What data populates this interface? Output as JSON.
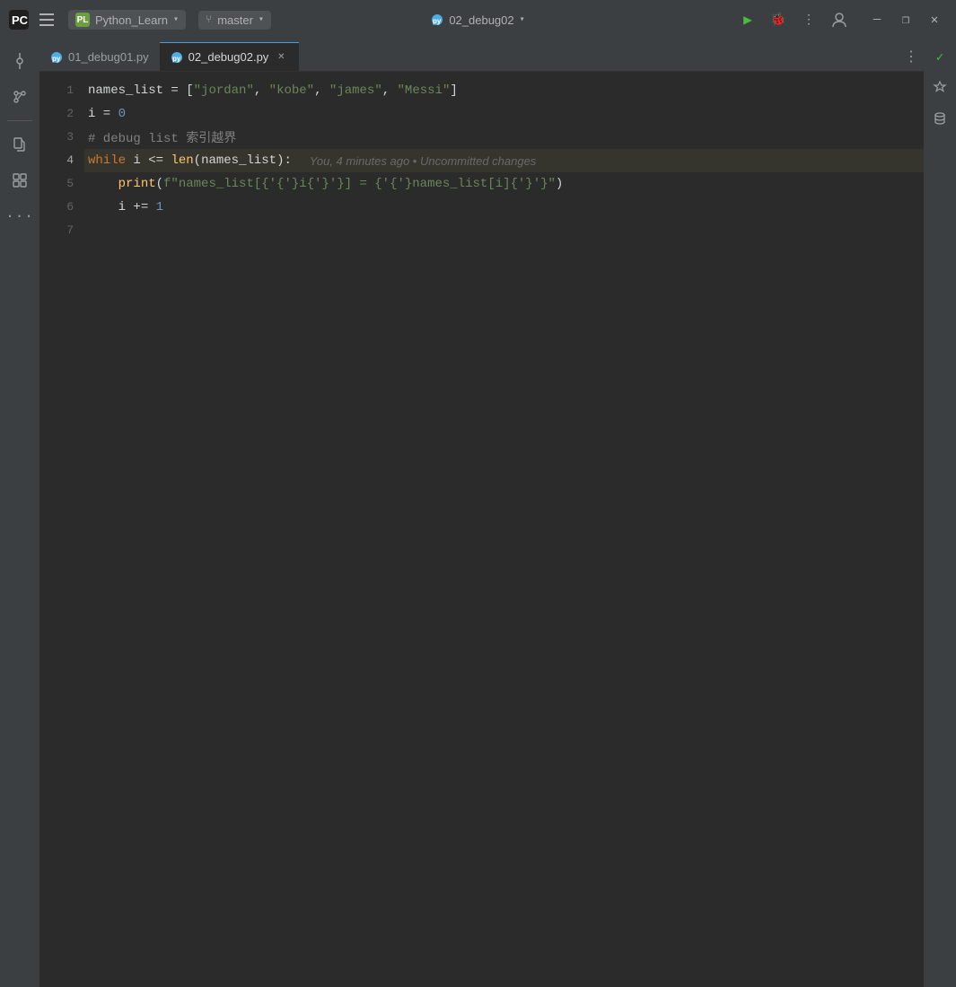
{
  "titleBar": {
    "appName": "PyCharm",
    "projectBadge": {
      "initials": "PL",
      "name": "Python_Learn",
      "chevron": "▾"
    },
    "branchBadge": {
      "name": "master",
      "chevron": "▾"
    },
    "fileTitle": {
      "name": "02_debug02",
      "chevron": "▾"
    },
    "runBtn": "▶",
    "debugBtn": "🐛",
    "moreBtn": "⋮",
    "userBtn": "👤",
    "minimizeBtn": "—",
    "maximizeBtn": "❐",
    "closeBtn": "✕"
  },
  "sidebar": {
    "icons": [
      {
        "id": "commit",
        "symbol": "⊙",
        "active": true
      },
      {
        "id": "branch",
        "symbol": "⑂",
        "active": false
      },
      {
        "id": "folder",
        "symbol": "📁",
        "active": false
      },
      {
        "id": "plugins",
        "symbol": "⊞",
        "active": false
      },
      {
        "id": "more",
        "symbol": "···",
        "active": false
      }
    ]
  },
  "tabs": [
    {
      "id": "tab1",
      "name": "01_debug01.py",
      "active": false
    },
    {
      "id": "tab2",
      "name": "02_debug02.py",
      "active": true,
      "closeable": true
    }
  ],
  "tabsMoreBtn": "⋮",
  "codeLines": [
    {
      "num": 1,
      "tokens": [
        {
          "text": "names_list",
          "cls": "var"
        },
        {
          "text": " = ",
          "cls": "op"
        },
        {
          "text": "[",
          "cls": "bracket"
        },
        {
          "text": "\"jordan\"",
          "cls": "str"
        },
        {
          "text": ", ",
          "cls": "punct"
        },
        {
          "text": "\"kobe\"",
          "cls": "str"
        },
        {
          "text": ", ",
          "cls": "punct"
        },
        {
          "text": "\"james\"",
          "cls": "str"
        },
        {
          "text": ", ",
          "cls": "punct"
        },
        {
          "text": "\"Messi\"",
          "cls": "str"
        },
        {
          "text": "]",
          "cls": "bracket"
        }
      ]
    },
    {
      "num": 2,
      "tokens": [
        {
          "text": "i",
          "cls": "var"
        },
        {
          "text": " = ",
          "cls": "op"
        },
        {
          "text": "0",
          "cls": "num"
        }
      ]
    },
    {
      "num": 3,
      "tokens": [
        {
          "text": "# debug list 索引越界",
          "cls": "comment"
        }
      ]
    },
    {
      "num": 4,
      "highlighted": true,
      "tokens": [
        {
          "text": "while",
          "cls": "kw"
        },
        {
          "text": " i <= ",
          "cls": "var"
        },
        {
          "text": "len",
          "cls": "fn"
        },
        {
          "text": "(",
          "cls": "bracket"
        },
        {
          "text": "names_list",
          "cls": "var"
        },
        {
          "text": "):",
          "cls": "punct"
        }
      ],
      "gitAnnotation": "You, 4 minutes ago • Uncommitted changes"
    },
    {
      "num": 5,
      "tokens": [
        {
          "text": "    ",
          "cls": "var"
        },
        {
          "text": "print",
          "cls": "fn"
        },
        {
          "text": "(",
          "cls": "bracket"
        },
        {
          "text": "f\"names_list[{i}] = {names_list[i]}\"",
          "cls": "str"
        },
        {
          "text": ")",
          "cls": "bracket"
        }
      ]
    },
    {
      "num": 6,
      "tokens": [
        {
          "text": "    ",
          "cls": "var"
        },
        {
          "text": "i",
          "cls": "var"
        },
        {
          "text": " += ",
          "cls": "op"
        },
        {
          "text": "1",
          "cls": "num"
        }
      ]
    },
    {
      "num": 7,
      "tokens": []
    }
  ],
  "rightSidebar": {
    "checkmark": "✓",
    "aiIcon": "✦",
    "dbIcon": "🗄"
  }
}
